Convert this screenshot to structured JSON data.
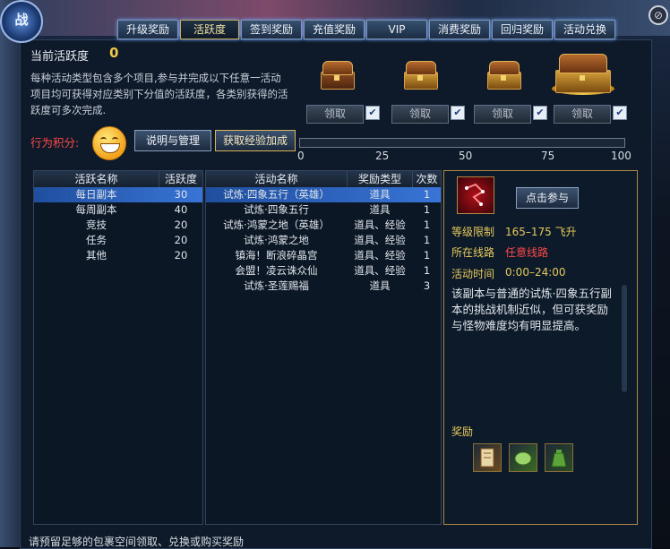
{
  "logo_text": "战",
  "tabs": [
    {
      "label": "升级奖励",
      "active": false
    },
    {
      "label": "活跃度",
      "active": true
    },
    {
      "label": "签到奖励",
      "active": false
    },
    {
      "label": "充值奖励",
      "active": false
    },
    {
      "label": "VIP",
      "active": false
    },
    {
      "label": "消费奖励",
      "active": false
    },
    {
      "label": "回归奖励",
      "active": false
    },
    {
      "label": "活动兑换",
      "active": false
    }
  ],
  "close_icon": "⊘",
  "activity": {
    "title": "当前活跃度",
    "value": "0",
    "description": "每种活动类型包含多个项目,参与并完成以下任意一活动项目均可获得对应类别下分值的活跃度，各类别获得的活跃度可多次完成."
  },
  "rewards": {
    "claim_label": "领取",
    "check_glyph": "✔"
  },
  "behavior": {
    "label": "行为积分:",
    "explain_button": "说明与管理",
    "exp_button": "获取经验加成"
  },
  "progress": {
    "value": 0,
    "ticks": [
      "0",
      "25",
      "50",
      "75",
      "100"
    ]
  },
  "categories": {
    "headers": [
      "活跃名称",
      "活跃度"
    ],
    "rows": [
      [
        "每日副本",
        "30"
      ],
      [
        "每周副本",
        "40"
      ],
      [
        "竞技",
        "20"
      ],
      [
        "任务",
        "20"
      ],
      [
        "其他",
        "20"
      ]
    ]
  },
  "activities": {
    "headers": [
      "活动名称",
      "奖励类型",
      "次数"
    ],
    "rows": [
      [
        "试炼·四象五行（英雄）",
        "道具",
        "1"
      ],
      [
        "试炼·四象五行",
        "道具",
        "1"
      ],
      [
        "试炼·鸿蒙之地（英雄）",
        "道具、经验",
        "1"
      ],
      [
        "试炼·鸿蒙之地",
        "道具、经验",
        "1"
      ],
      [
        "镇海！断浪碎晶宫",
        "道具、经验",
        "1"
      ],
      [
        "会盟！凌云诛众仙",
        "道具、经验",
        "1"
      ],
      [
        "试炼·圣莲赐福",
        "道具",
        "3"
      ]
    ]
  },
  "detail": {
    "join_button": "点击参与",
    "level_label": "等级限制",
    "level_value": "165–175  飞升",
    "line_label": "所在线路",
    "line_value": "任意线路",
    "time_label": "活动时间",
    "time_value": "0:00–24:00",
    "text": "该副本与普通的试炼·四象五行副本的挑战机制近似，但可获奖励与怪物难度均有明显提高。",
    "reward_label": "奖励"
  },
  "footer": "请预留足够的包裹空间领取、兑换或购买奖励",
  "colors": {
    "accent_gold": "#f2c84b",
    "red": "#ff4848",
    "selected_row": "#2f66c4"
  }
}
